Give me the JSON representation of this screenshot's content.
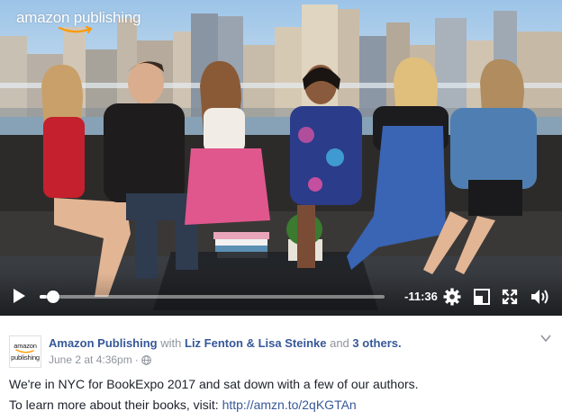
{
  "video": {
    "watermark": "amazon publishing",
    "elapsed_fraction": 0.02,
    "time_remaining": "-11:36",
    "icons": {
      "play": "play-icon",
      "settings": "gear-icon",
      "theater": "theater-mode-icon",
      "fullscreen": "fullscreen-icon",
      "volume": "volume-icon"
    }
  },
  "post": {
    "avatar": {
      "line1": "amazon",
      "line2": "publishing"
    },
    "page_name": "Amazon Publishing",
    "with_word": "with",
    "tagged_people": "Liz Fenton & Lisa Steinke",
    "and_word": "and",
    "others": "3 others.",
    "date": "June 2 at 4:36pm",
    "separator": "·",
    "privacy_icon": "globe-icon",
    "menu_icon": "chevron-down-icon",
    "text_line1": "We're in NYC for BookExpo 2017 and sat down with a few of our authors.",
    "text_line2_prefix": "To learn more about their books, visit:",
    "link": "http://amzn.to/2qKGTAn"
  },
  "colors": {
    "link_blue": "#365899",
    "meta_gray": "#90949c",
    "text_dark": "#1d2129",
    "amazon_orange": "#ff9900"
  }
}
